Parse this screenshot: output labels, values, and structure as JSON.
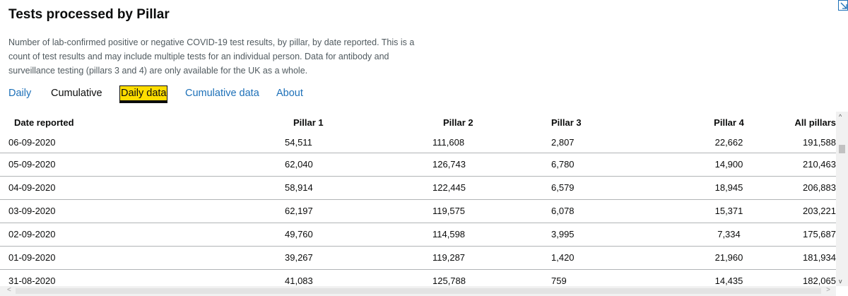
{
  "header": {
    "title": "Tests processed by Pillar",
    "description": "Number of lab-confirmed positive or negative COVID-19 test results, by pillar, by date reported. This is a count of test results and may include multiple tests for an individual person. Data for antibody and surveillance testing (pillars 3 and 4) are only available for the UK as a whole."
  },
  "tabs": [
    {
      "label": "Daily"
    },
    {
      "label": "Cumulative"
    },
    {
      "label": "Daily data"
    },
    {
      "label": "Cumulative data"
    },
    {
      "label": "About"
    }
  ],
  "table": {
    "columns": [
      "Date reported",
      "Pillar 1",
      "Pillar 2",
      "Pillar 3",
      "Pillar 4",
      "All pillars"
    ],
    "rows": [
      [
        "06-09-2020",
        "54,511",
        "111,608",
        "2,807",
        "22,662",
        "191,588"
      ],
      [
        "05-09-2020",
        "62,040",
        "126,743",
        "6,780",
        "14,900",
        "210,463"
      ],
      [
        "04-09-2020",
        "58,914",
        "122,445",
        "6,579",
        "18,945",
        "206,883"
      ],
      [
        "03-09-2020",
        "62,197",
        "119,575",
        "6,078",
        "15,371",
        "203,221"
      ],
      [
        "02-09-2020",
        "49,760",
        "114,598",
        "3,995",
        "7,334",
        "175,687"
      ],
      [
        "01-09-2020",
        "39,267",
        "119,287",
        "1,420",
        "21,960",
        "181,934"
      ],
      [
        "31-08-2020",
        "41,083",
        "125,788",
        "759",
        "14,435",
        "182,065"
      ]
    ]
  },
  "icons": {
    "corner": "download-icon",
    "scroll_up": "chevron-up-icon",
    "scroll_down": "chevron-down-icon",
    "scroll_left": "chevron-left-icon",
    "scroll_right": "chevron-right-icon"
  },
  "colors": {
    "link": "#1d70b8",
    "active_tab_bg": "#ffdd00",
    "text": "#0b0c0c",
    "secondary_text": "#505a5f"
  }
}
